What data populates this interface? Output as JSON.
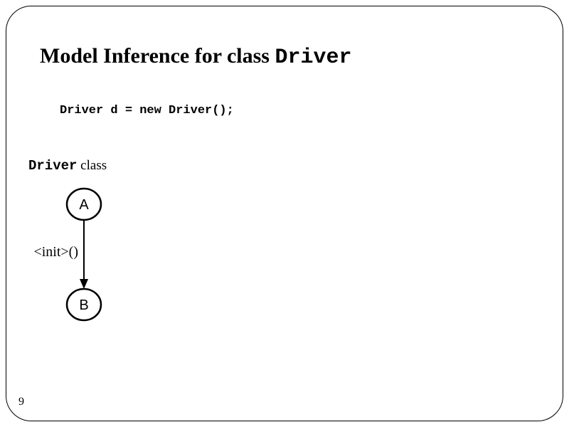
{
  "title": {
    "prefix": "Model Inference for class ",
    "classname": "Driver"
  },
  "code": "Driver d = new Driver();",
  "class_label": {
    "classname": "Driver",
    "suffix": " class"
  },
  "diagram": {
    "nodeA": "A",
    "nodeB": "B",
    "edge_label": "<init>()"
  },
  "page_number": "9"
}
